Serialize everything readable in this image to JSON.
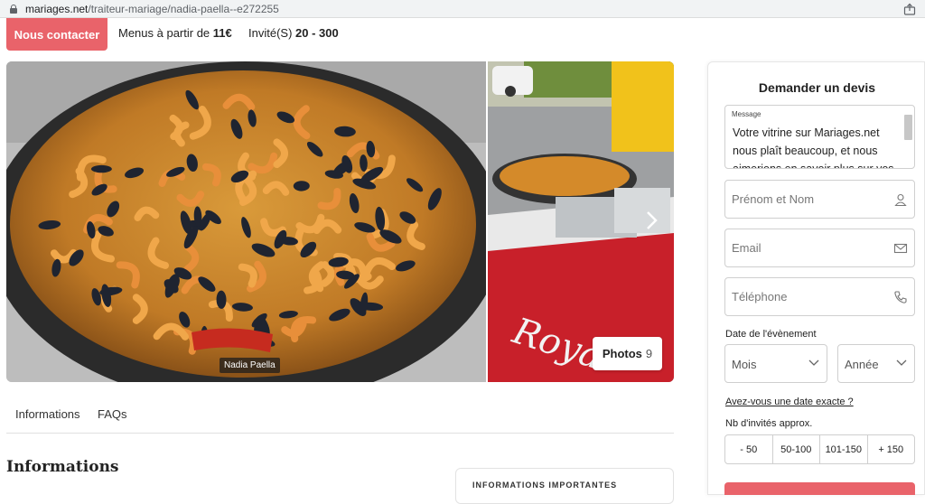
{
  "browser": {
    "url_domain": "mariages.net",
    "url_path": "/traiteur-mariage/nadia-paella--e272255"
  },
  "topbar": {
    "contact_label": "Nous contacter",
    "menus_prefix": "Menus à partir de ",
    "menus_price": "11€",
    "guests_prefix": "Invité(S) ",
    "guests_range": "20 - 300"
  },
  "gallery": {
    "photo_tag": "Nadia Paella",
    "photos_label": "Photos",
    "photos_count": "9",
    "side_sign_text": "Roya"
  },
  "tabs": {
    "items": [
      "Informations",
      "FAQs"
    ]
  },
  "main": {
    "section_title": "Informations",
    "card_heading": "INFORMATIONS IMPORTANTES"
  },
  "form": {
    "title": "Demander un devis",
    "message_label": "Message",
    "message_text": "Votre vitrine sur Mariages.net nous plaît beaucoup, et nous aimerions en savoir plus sur vos",
    "name_placeholder": "Prénom et Nom",
    "email_placeholder": "Email",
    "phone_placeholder": "Téléphone",
    "date_label": "Date de l'évènement",
    "month_placeholder": "Mois",
    "year_placeholder": "Année",
    "exact_date_link": "Avez-vous une date exacte ?",
    "guests_label": "Nb d'invités approx.",
    "guest_options": [
      "- 50",
      "50-100",
      "101-150",
      "+ 150"
    ]
  },
  "colors": {
    "accent": "#e9636a"
  }
}
